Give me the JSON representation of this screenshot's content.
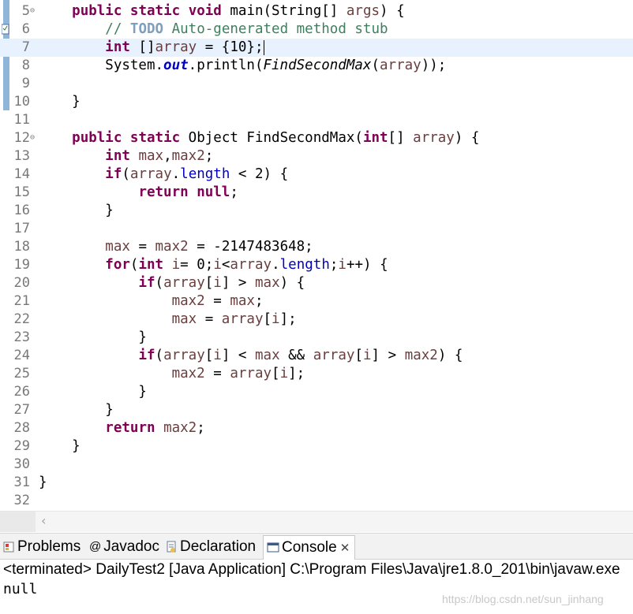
{
  "editor": {
    "lines": [
      {
        "n": "5",
        "html": "    <span class=\"kw\">public</span> <span class=\"kw\">static</span> <span class=\"kw\">void</span> main(String[] <span class=\"var\">args</span>) {"
      },
      {
        "n": "6",
        "html": "        <span class=\"cm\">// </span><span class=\"todo\">TODO</span><span class=\"cm\"> Auto-generated method stub</span>"
      },
      {
        "n": "7",
        "html": "        <span class=\"kw\">int</span> []<span class=\"var\">array</span> = {10};<span class=\"caret\"></span>"
      },
      {
        "n": "8",
        "html": "        System.<span class=\"sfld\">out</span>.println(<span class=\"ital\">FindSecondMax</span>(<span class=\"var\">array</span>));"
      },
      {
        "n": "9",
        "html": ""
      },
      {
        "n": "10",
        "html": "    }"
      },
      {
        "n": "11",
        "html": ""
      },
      {
        "n": "12",
        "html": "    <span class=\"kw\">public</span> <span class=\"kw\">static</span> Object FindSecondMax(<span class=\"kw\">int</span>[] <span class=\"var\">array</span>) {"
      },
      {
        "n": "13",
        "html": "        <span class=\"kw\">int</span> <span class=\"var\">max</span>,<span class=\"var\">max2</span>;"
      },
      {
        "n": "14",
        "html": "        <span class=\"kw\">if</span>(<span class=\"var\">array</span>.<span class=\"fld\">length</span> &lt; 2) {"
      },
      {
        "n": "15",
        "html": "            <span class=\"kw\">return</span> <span class=\"kw\">null</span>;"
      },
      {
        "n": "16",
        "html": "        }"
      },
      {
        "n": "17",
        "html": ""
      },
      {
        "n": "18",
        "html": "        <span class=\"var\">max</span> = <span class=\"var\">max2</span> = -2147483648;"
      },
      {
        "n": "19",
        "html": "        <span class=\"kw\">for</span>(<span class=\"kw\">int</span> <span class=\"var\">i</span>= 0;<span class=\"var\">i</span>&lt;<span class=\"var\">array</span>.<span class=\"fld\">length</span>;<span class=\"var\">i</span>++) {"
      },
      {
        "n": "20",
        "html": "            <span class=\"kw\">if</span>(<span class=\"var\">array</span>[<span class=\"var\">i</span>] &gt; <span class=\"var\">max</span>) {"
      },
      {
        "n": "21",
        "html": "                <span class=\"var\">max2</span> = <span class=\"var\">max</span>;"
      },
      {
        "n": "22",
        "html": "                <span class=\"var\">max</span> = <span class=\"var\">array</span>[<span class=\"var\">i</span>];"
      },
      {
        "n": "23",
        "html": "            }"
      },
      {
        "n": "24",
        "html": "            <span class=\"kw\">if</span>(<span class=\"var\">array</span>[<span class=\"var\">i</span>] &lt; <span class=\"var\">max</span> &amp;&amp; <span class=\"var\">array</span>[<span class=\"var\">i</span>] &gt; <span class=\"var\">max2</span>) {"
      },
      {
        "n": "25",
        "html": "                <span class=\"var\">max2</span> = <span class=\"var\">array</span>[<span class=\"var\">i</span>];"
      },
      {
        "n": "26",
        "html": "            }"
      },
      {
        "n": "27",
        "html": "        }"
      },
      {
        "n": "28",
        "html": "        <span class=\"kw\">return</span> <span class=\"var\">max2</span>;"
      },
      {
        "n": "29",
        "html": "    }"
      },
      {
        "n": "30",
        "html": ""
      },
      {
        "n": "31",
        "html": "}"
      },
      {
        "n": "32",
        "html": ""
      }
    ],
    "current_line": "7",
    "folded_markers": [
      "5",
      "12"
    ]
  },
  "tabs": {
    "problems": "Problems",
    "javadoc": "Javadoc",
    "declaration": "Declaration",
    "console": "Console"
  },
  "console": {
    "status": "<terminated> DailyTest2 [Java Application] C:\\Program Files\\Java\\jre1.8.0_201\\bin\\javaw.exe",
    "output": "null"
  },
  "watermark": "https://blog.csdn.net/sun_jinhang",
  "colors": {
    "keyword": "#7f0055",
    "comment": "#3f7f5f",
    "field": "#0000c0",
    "current_line": "#e8f2fe"
  }
}
